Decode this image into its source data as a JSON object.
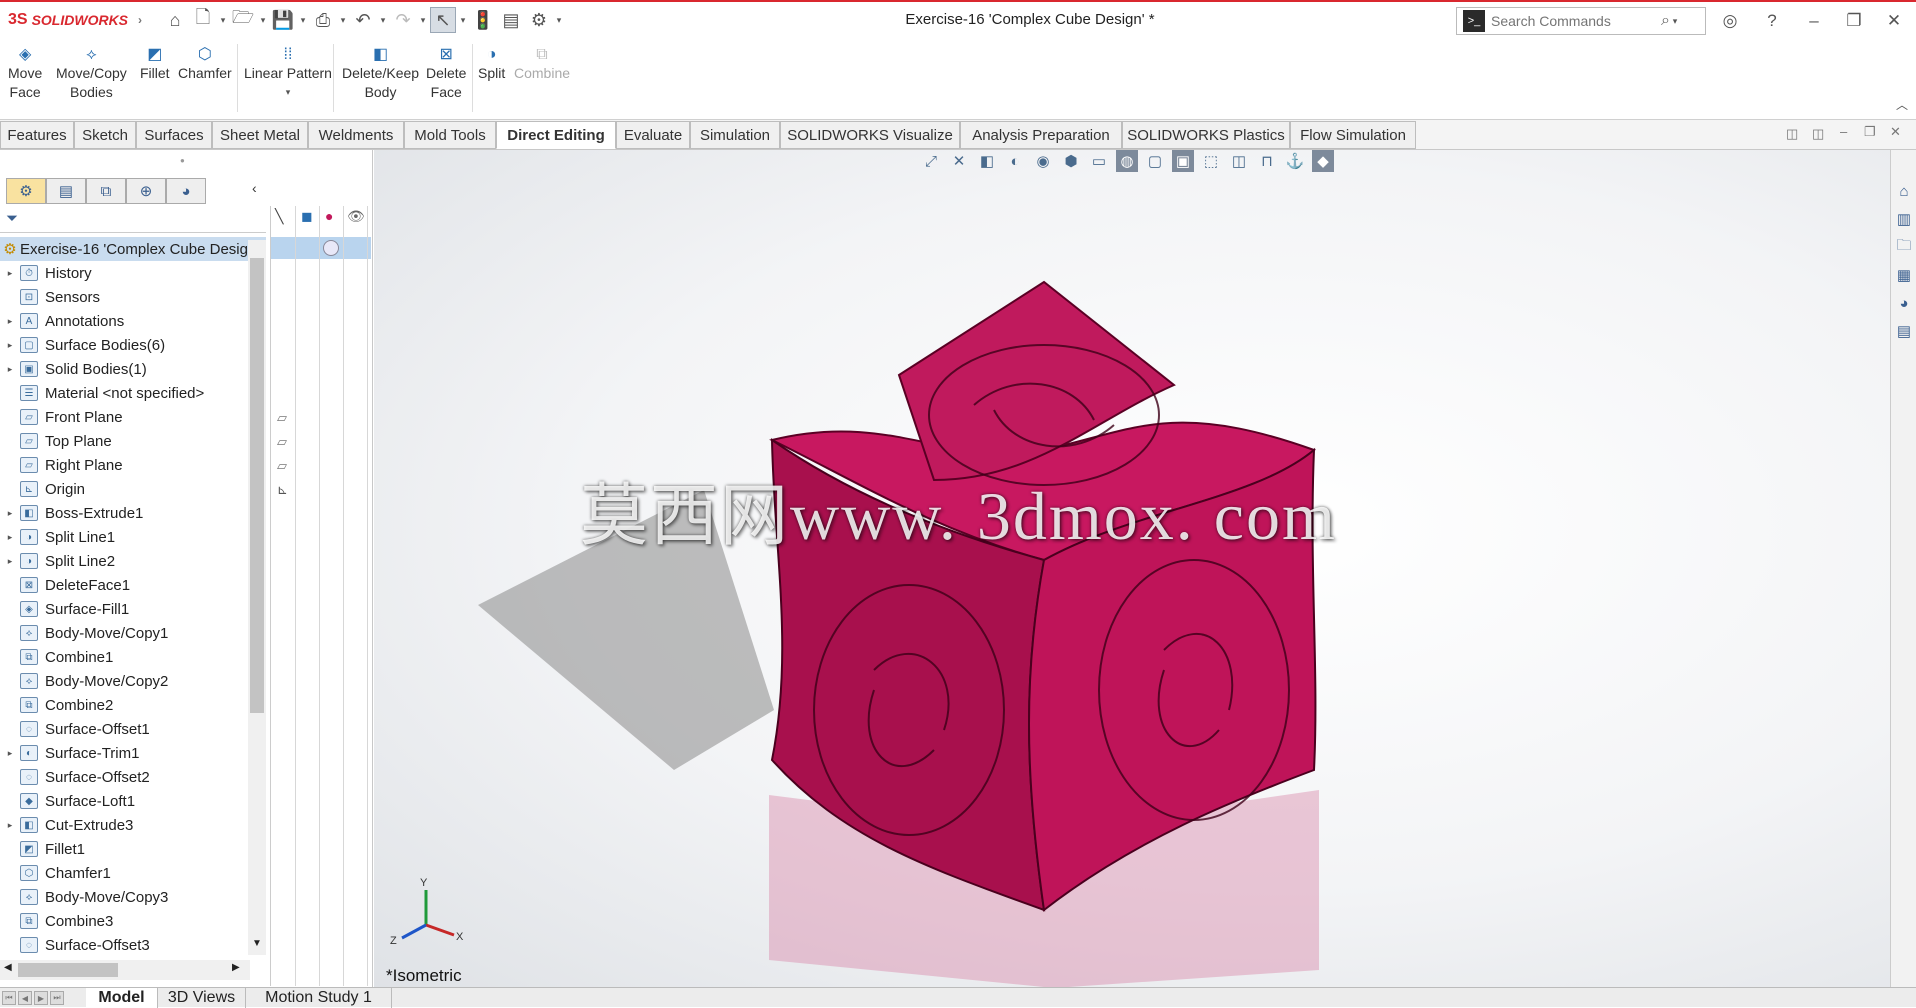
{
  "app": {
    "logo_text": "SOLIDWORKS",
    "logo_mark": "3S"
  },
  "window": {
    "title": "Exercise-16 'Complex Cube Design' *"
  },
  "search": {
    "placeholder": "Search Commands"
  },
  "commands": [
    {
      "label_1": "Move",
      "label_2": "Face"
    },
    {
      "label_1": "Move/Copy",
      "label_2": "Bodies"
    },
    {
      "label_1": "Fillet",
      "label_2": ""
    },
    {
      "label_1": "Chamfer",
      "label_2": ""
    },
    {
      "label_1": "Linear Pattern",
      "label_2": ""
    },
    {
      "label_1": "Delete/Keep",
      "label_2": "Body"
    },
    {
      "label_1": "Delete",
      "label_2": "Face"
    },
    {
      "label_1": "Split",
      "label_2": ""
    },
    {
      "label_1": "Combine",
      "label_2": ""
    }
  ],
  "tabs": [
    "Features",
    "Sketch",
    "Surfaces",
    "Sheet Metal",
    "Weldments",
    "Mold Tools",
    "Direct Editing",
    "Evaluate",
    "Simulation",
    "SOLIDWORKS Visualize",
    "Analysis Preparation",
    "SOLIDWORKS Plastics",
    "Flow Simulation"
  ],
  "active_tab": "Direct Editing",
  "tree": {
    "root": "Exercise-16 'Complex Cube Desig",
    "items": [
      {
        "label": "History",
        "arrow": "▸"
      },
      {
        "label": "Sensors",
        "arrow": ""
      },
      {
        "label": "Annotations",
        "arrow": "▸"
      },
      {
        "label": "Surface Bodies(6)",
        "arrow": "▸"
      },
      {
        "label": "Solid Bodies(1)",
        "arrow": "▸"
      },
      {
        "label": "Material <not specified>",
        "arrow": ""
      },
      {
        "label": "Front Plane",
        "arrow": ""
      },
      {
        "label": "Top Plane",
        "arrow": ""
      },
      {
        "label": "Right Plane",
        "arrow": ""
      },
      {
        "label": "Origin",
        "arrow": ""
      },
      {
        "label": "Boss-Extrude1",
        "arrow": "▸"
      },
      {
        "label": "Split Line1",
        "arrow": "▸"
      },
      {
        "label": "Split Line2",
        "arrow": "▸"
      },
      {
        "label": "DeleteFace1",
        "arrow": ""
      },
      {
        "label": "Surface-Fill1",
        "arrow": ""
      },
      {
        "label": "Body-Move/Copy1",
        "arrow": ""
      },
      {
        "label": "Combine1",
        "arrow": ""
      },
      {
        "label": "Body-Move/Copy2",
        "arrow": ""
      },
      {
        "label": "Combine2",
        "arrow": ""
      },
      {
        "label": "Surface-Offset1",
        "arrow": ""
      },
      {
        "label": "Surface-Trim1",
        "arrow": "▸"
      },
      {
        "label": "Surface-Offset2",
        "arrow": ""
      },
      {
        "label": "Surface-Loft1",
        "arrow": ""
      },
      {
        "label": "Cut-Extrude3",
        "arrow": "▸"
      },
      {
        "label": "Fillet1",
        "arrow": ""
      },
      {
        "label": "Chamfer1",
        "arrow": ""
      },
      {
        "label": "Body-Move/Copy3",
        "arrow": ""
      },
      {
        "label": "Combine3",
        "arrow": ""
      },
      {
        "label": "Surface-Offset3",
        "arrow": ""
      }
    ]
  },
  "viewport": {
    "watermark": "莫西网www. 3dmox. com",
    "view_name": "*Isometric",
    "triad": {
      "x": "X",
      "y": "Y",
      "z": "Z"
    },
    "model_color": "#c2185b"
  },
  "bottom_tabs": [
    "Model",
    "3D Views",
    "Motion Study 1"
  ],
  "active_bottom_tab": "Model"
}
